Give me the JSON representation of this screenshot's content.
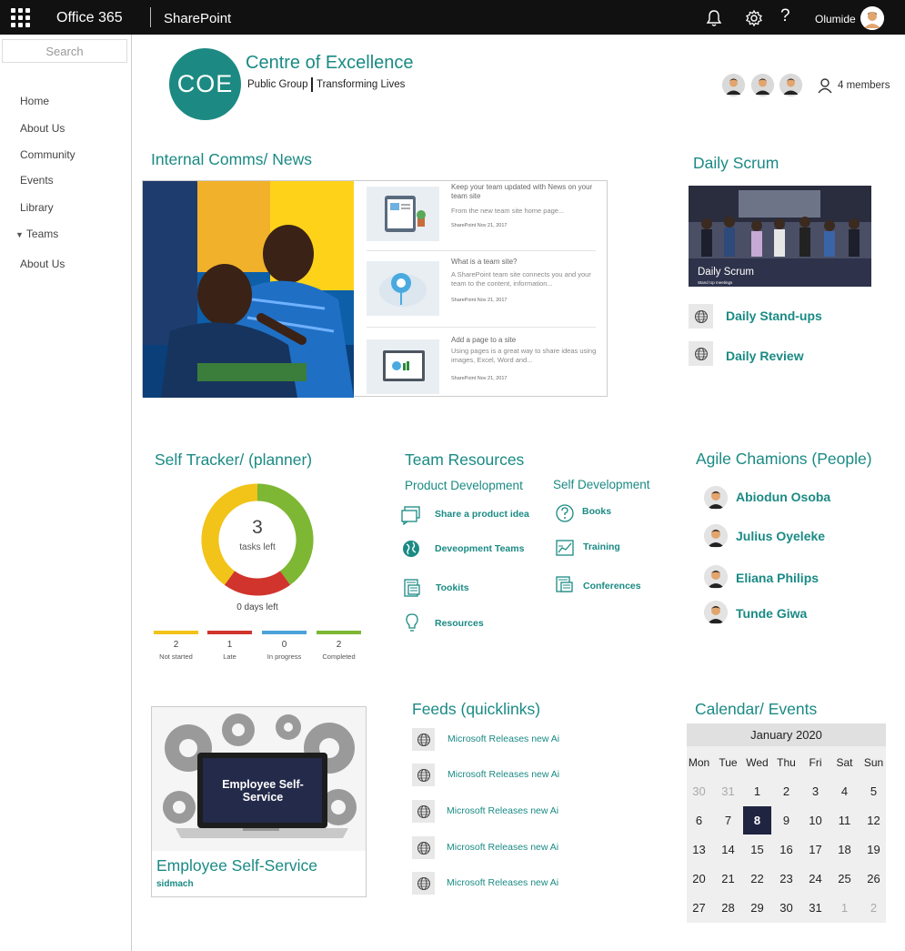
{
  "topbar": {
    "app": "Office 365",
    "site": "SharePoint",
    "user": "Olumide"
  },
  "nav": {
    "search_placeholder": "Search",
    "items": [
      "Home",
      "About Us",
      "Community",
      "Events",
      "Library",
      "Teams",
      "About Us"
    ]
  },
  "site": {
    "logo_text": "COE",
    "title": "Centre of Excellence",
    "group_type": "Public Group",
    "tagline": "Transforming Lives",
    "members": "4 members"
  },
  "news": {
    "heading": "Internal Comms/ News",
    "items": [
      {
        "title": "Keep your team updated with News on your team site",
        "desc": "From the new team site home page...",
        "meta": "SharePoint  Nov 21, 2017"
      },
      {
        "title": "What is a team site?",
        "desc": "A SharePoint team site connects you and your team to the content, information...",
        "meta": "SharePoint  Nov 21, 2017"
      },
      {
        "title": "Add a page to a site",
        "desc": "Using pages is a great way to share ideas using images, Excel, Word and...",
        "meta": "SharePoint  Nov 21, 2017"
      }
    ]
  },
  "scrum": {
    "heading": "Daily Scrum",
    "image_label": "Daily Scrum",
    "image_sublabel": "Stand Up meetings",
    "links": [
      "Daily Stand-ups",
      "Daily Review"
    ]
  },
  "tracker": {
    "heading": "Self Tracker/ (planner)",
    "tasks_left": "3",
    "tasks_label": "tasks left",
    "days_left": "0 days left",
    "statuses": [
      {
        "label": "Not started",
        "count": "2",
        "color": "#f2c318"
      },
      {
        "label": "Late",
        "count": "1",
        "color": "#d0342c"
      },
      {
        "label": "In progress",
        "count": "0",
        "color": "#4aa2d9"
      },
      {
        "label": "Completed",
        "count": "2",
        "color": "#7db733"
      }
    ],
    "donut": {
      "Not started": 2,
      "Late": 1,
      "In progress": 0,
      "Completed": 2
    }
  },
  "resources": {
    "heading": "Team Resources",
    "product_heading": "Product Development",
    "self_heading": "Self Development",
    "product_links": [
      "Share a product idea",
      "Deveopment Teams",
      "Tookits",
      "Resources"
    ],
    "self_links": [
      "Books",
      "Training",
      "Conferences"
    ]
  },
  "people": {
    "heading": "Agile Chamions (People)",
    "names": [
      "Abiodun Osoba",
      "Julius Oyeleke",
      "Eliana Philips",
      "Tunde Giwa"
    ]
  },
  "ess": {
    "image_text": "Employee Self-Service",
    "title": "Employee Self-Service",
    "subtitle": "sidmach"
  },
  "feeds": {
    "heading": "Feeds (quicklinks)",
    "items": [
      "Microsoft Releases new Ai",
      "Microsoft Releases new Ai",
      "Microsoft Releases new Ai",
      "Microsoft Releases new Ai",
      "Microsoft Releases new Ai"
    ]
  },
  "calendar": {
    "heading": "Calendar/ Events",
    "month": "January 2020",
    "weekdays": [
      "Mon",
      "Tue",
      "Wed",
      "Thu",
      "Fri",
      "Sat",
      "Sun"
    ],
    "days": [
      "30",
      "31",
      "1",
      "2",
      "3",
      "4",
      "5",
      "6",
      "7",
      "8",
      "9",
      "10",
      "11",
      "12",
      "13",
      "14",
      "15",
      "16",
      "17",
      "18",
      "19",
      "20",
      "21",
      "22",
      "23",
      "24",
      "25",
      "26",
      "27",
      "28",
      "29",
      "30",
      "31",
      "1",
      "2"
    ],
    "selected": "8"
  }
}
